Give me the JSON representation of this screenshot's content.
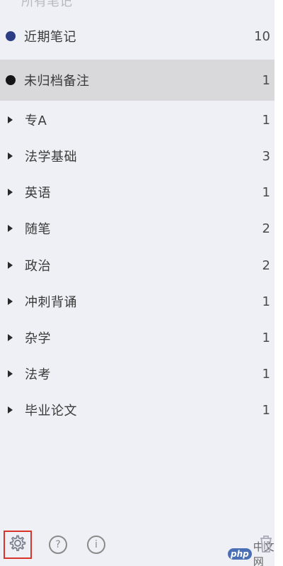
{
  "colors": {
    "sidebar_bg": "#eff0f5",
    "selected_bg": "#d9d9db",
    "recent_dot": "#2d3d85",
    "unfiled_dot": "#151515",
    "settings_highlight": "#d8342a"
  },
  "top_cut_label": "所有笔记",
  "smart_items": [
    {
      "label": "近期笔记",
      "count": "10",
      "icon": "navy-dot"
    },
    {
      "label": "未归档备注",
      "count": "1",
      "icon": "black-dot"
    }
  ],
  "notebooks": [
    {
      "label": "专A",
      "count": "1"
    },
    {
      "label": "法学基础",
      "count": "3"
    },
    {
      "label": "英语",
      "count": "1"
    },
    {
      "label": "随笔",
      "count": "2"
    },
    {
      "label": "政治",
      "count": "2"
    },
    {
      "label": "冲刺背诵",
      "count": "1"
    },
    {
      "label": "杂学",
      "count": "1"
    },
    {
      "label": "法考",
      "count": "1"
    },
    {
      "label": "毕业论文",
      "count": "1"
    }
  ],
  "toolbar": {
    "settings_icon": "gear-icon",
    "help_icon": "question-circle-icon",
    "info_icon": "info-circle-icon",
    "trash_icon": "trash-icon",
    "help_glyph": "?",
    "info_glyph": "i"
  },
  "watermark": {
    "badge": "php",
    "text": "中文网"
  }
}
